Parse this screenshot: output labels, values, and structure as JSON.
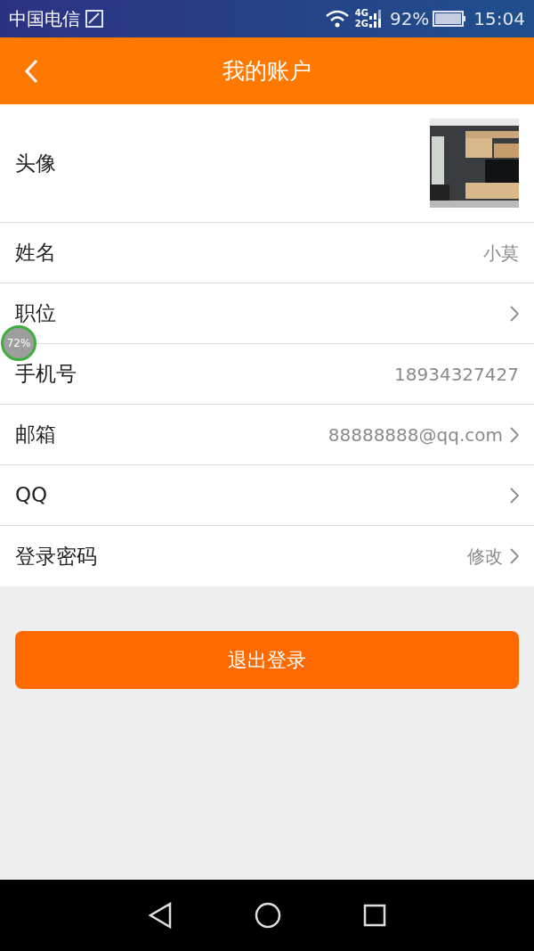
{
  "status_bar": {
    "carrier": "中国电信",
    "network_top": "4G",
    "network_bottom": "2G",
    "battery": "92%",
    "time": "15:04"
  },
  "header": {
    "title": "我的账户"
  },
  "rows": [
    {
      "kind": "avatar",
      "label": "头像"
    },
    {
      "kind": "text",
      "label": "姓名",
      "value": "小莫",
      "arrow": false
    },
    {
      "kind": "text",
      "label": "职位",
      "arrow": true
    },
    {
      "kind": "text",
      "label": "手机号",
      "value": "18934327427",
      "arrow": false
    },
    {
      "kind": "text",
      "label": "邮箱",
      "value": "88888888@qq.com",
      "arrow": true
    },
    {
      "kind": "text",
      "label": "QQ",
      "arrow": true
    },
    {
      "kind": "text",
      "label": "登录密码",
      "value": "修改",
      "arrow": true
    }
  ],
  "logout_button": "退出登录",
  "float_badge": "72%"
}
